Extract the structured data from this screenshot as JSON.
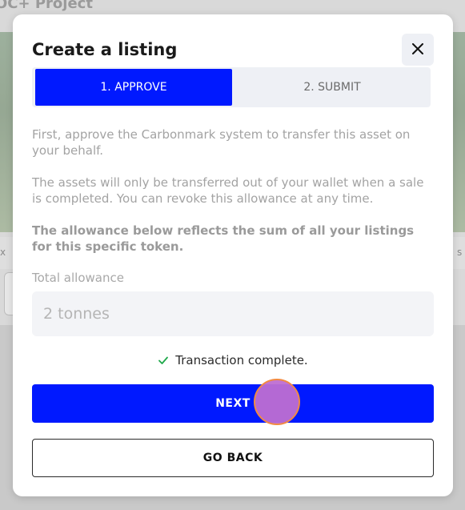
{
  "background": {
    "title": "OC+ Project"
  },
  "modal": {
    "title": "Create a listing",
    "close_icon": "close-icon",
    "tabs": [
      {
        "label": "1. APPROVE",
        "active": true
      },
      {
        "label": "2. SUBMIT",
        "active": false
      }
    ],
    "paragraphs": [
      "First, approve the Carbonmark system to transfer this asset on your behalf.",
      "The assets will only be transferred out of your wallet when a sale is completed. You can revoke this allowance at any time.",
      "The allowance below reflects the sum of all your listings for this specific token."
    ],
    "allowance": {
      "label": "Total allowance",
      "value": "2 tonnes"
    },
    "status": {
      "icon": "check-icon",
      "text": "Transaction complete."
    },
    "buttons": {
      "next": "NEXT",
      "go_back": "GO BACK"
    }
  },
  "colors": {
    "accent": "#0019ff",
    "success": "#1ea84a",
    "cursor": "#be6ed2",
    "cursor_outline": "#f28a42"
  }
}
